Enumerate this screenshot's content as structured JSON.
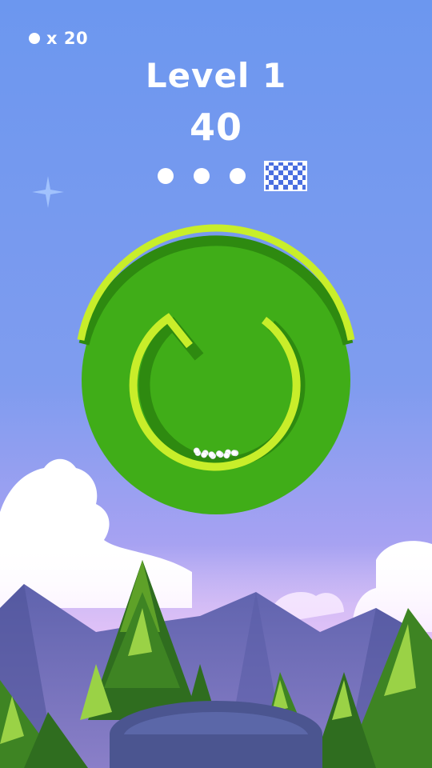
{
  "hud": {
    "ball_count": "x 20",
    "level_title": "Level 1",
    "score": "40"
  },
  "progress": {
    "stages_total": 3,
    "stages_completed": 0,
    "finish_icon": "checkered-flag-icon"
  },
  "colors": {
    "sky_top": "#6a95ee",
    "sky_bottom": "#c9a6f0",
    "wheel_green": "#3fae17",
    "ring_lime": "#c8ee2a",
    "ring_shadow": "#2e8a10",
    "mountain": "#6d6fb4",
    "tree_dark": "#2f6d1f",
    "tree_light": "#89c93a",
    "cup": "#4b5590",
    "ball": "#ffffff"
  },
  "game": {
    "balls_in_wheel": 12
  }
}
